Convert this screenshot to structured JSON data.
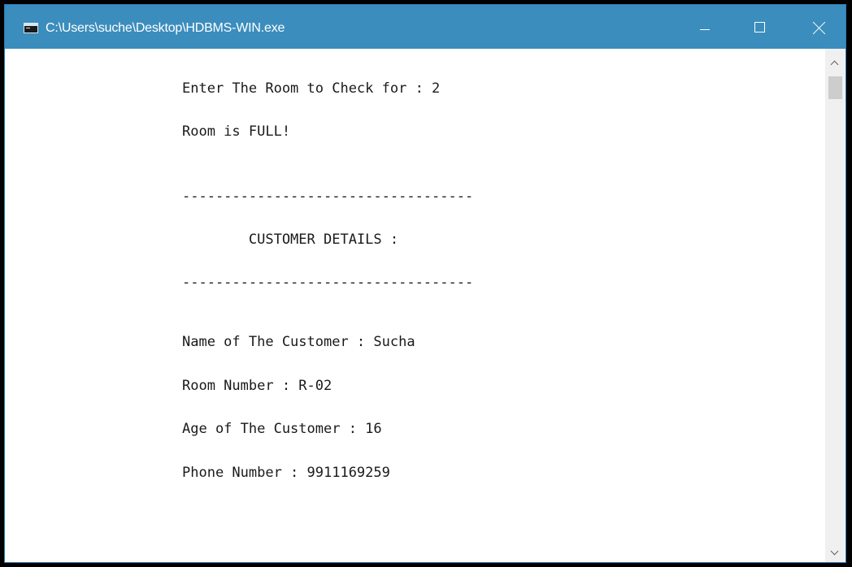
{
  "window": {
    "title": "C:\\Users\\suche\\Desktop\\HDBMS-WIN.exe",
    "titlebar_color": "#3b8dbd",
    "icons": {
      "app": "console-app-icon",
      "minimize": "minimize-icon",
      "maximize": "maximize-icon",
      "close": "close-icon"
    }
  },
  "console": {
    "lines": [
      "Enter The Room to Check for : 2",
      "Room is FULL!",
      "-----------------------------------",
      "        CUSTOMER DETAILS :",
      "-----------------------------------",
      "Name of The Customer : Sucha",
      "Room Number : R-02",
      "Age of The Customer : 16",
      "Phone Number : 9911169259"
    ]
  },
  "scrollbar": {
    "up_icon": "chevron-up-icon",
    "down_icon": "chevron-down-icon"
  }
}
